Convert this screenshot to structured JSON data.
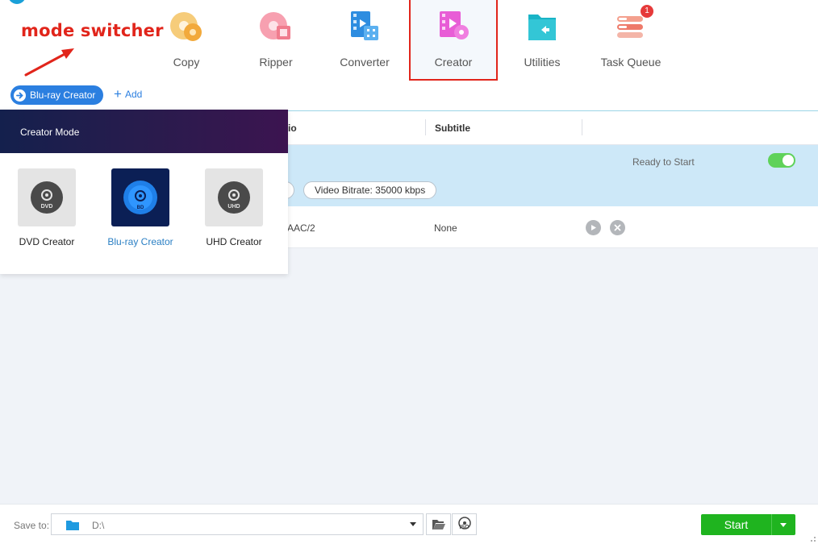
{
  "annotation": {
    "text": "mode switcher",
    "color": "#e1251b"
  },
  "nav": {
    "items": [
      {
        "label": "Copy",
        "icon": "copy-disc-icon"
      },
      {
        "label": "Ripper",
        "icon": "ripper-disc-icon"
      },
      {
        "label": "Converter",
        "icon": "converter-film-icon"
      },
      {
        "label": "Creator",
        "icon": "creator-film-icon",
        "active": true
      },
      {
        "label": "Utilities",
        "icon": "utilities-folder-icon"
      },
      {
        "label": "Task Queue",
        "icon": "task-queue-icon",
        "badge": "1"
      }
    ]
  },
  "mode_switcher": {
    "label": "Blu-ray Creator",
    "add_label": "Add"
  },
  "table": {
    "columns": [
      "io",
      "Subtitle"
    ],
    "selected_row": {
      "status": "Ready to Start",
      "toggle_on": true,
      "video_bitrate": "Video Bitrate: 35000 kbps"
    },
    "track_row": {
      "audio": "AAC/2",
      "subtitle": "None"
    }
  },
  "creator_mode": {
    "title": "Creator Mode",
    "modes": [
      {
        "label": "DVD Creator",
        "icon": "dvd-disc-icon"
      },
      {
        "label": "Blu-ray Creator",
        "icon": "bluray-disc-icon",
        "selected": true
      },
      {
        "label": "UHD Creator",
        "icon": "uhd-disc-icon"
      }
    ]
  },
  "bottom": {
    "save_label": "Save to:",
    "path": "D:\\",
    "iso_label": "ISO",
    "start_label": "Start"
  },
  "colors": {
    "accent_blue": "#2b7fe0",
    "start_green": "#1fb41f",
    "selected_row": "#cde8f8",
    "highlight_red": "#e1251b"
  }
}
